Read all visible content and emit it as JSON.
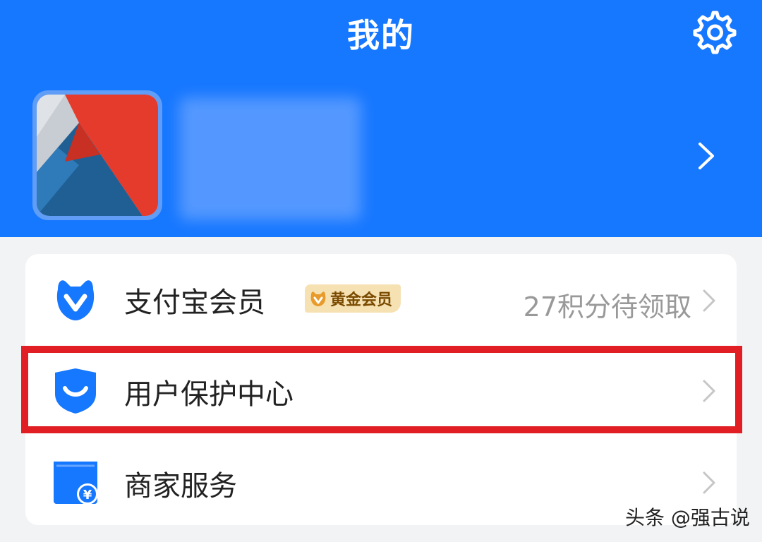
{
  "header": {
    "title": "我的"
  },
  "icons": {
    "settings": "gear-icon",
    "profile_more": "chevron-right-icon",
    "member": "alipay-member-icon",
    "protection": "shield-smile-icon",
    "merchant": "shop-yuan-icon"
  },
  "list": {
    "member": {
      "label": "支付宝会员",
      "badge": "黄金会员",
      "extra": "27积分待领取"
    },
    "protection": {
      "label": "用户保护中心"
    },
    "merchant": {
      "label": "商家服务"
    }
  },
  "watermark": "头条 @强古说",
  "colors": {
    "brand_blue": "#1677ff",
    "highlight_red": "#e01e24",
    "badge_gold": "#f6e1b3"
  }
}
